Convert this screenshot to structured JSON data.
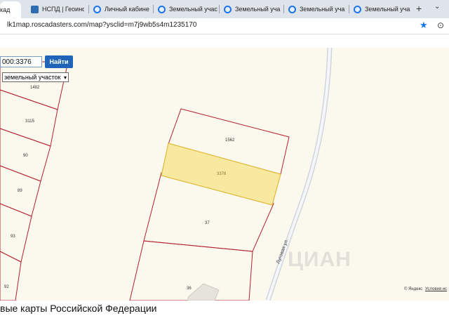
{
  "tabs": [
    {
      "label": "кад",
      "favicon": "globe-icon",
      "active": true
    },
    {
      "label": "НСПД | Геоинф",
      "favicon": "nspd-icon"
    },
    {
      "label": "Личный кабине",
      "favicon": "globe-icon"
    },
    {
      "label": "Земельный учас",
      "favicon": "globe-icon"
    },
    {
      "label": "Земельный уча",
      "favicon": "globe-icon"
    },
    {
      "label": "Земельный уча",
      "favicon": "globe-icon"
    },
    {
      "label": "Земельный уча",
      "favicon": "globe-icon"
    }
  ],
  "new_tab": "+",
  "tab_menu": "⌄",
  "address": {
    "url": "lk1map.roscadasters.com/map?ysclid=m7j9wb5s4m1235170"
  },
  "search": {
    "value": "000:3376",
    "button": "Найти",
    "type_select": "земельный участок"
  },
  "parcels": {
    "left": [
      "1482",
      "3115",
      "90",
      "89",
      "93",
      "92"
    ],
    "center": [
      "1562",
      "3376",
      "37",
      "36"
    ],
    "selected": "3376"
  },
  "road_label": "Луговая ул.",
  "attribution": {
    "yandex": "© Яндекс",
    "terms": "Условия ис"
  },
  "watermark": "ЦИАН",
  "page_heading": "вые карты Российской Федерации",
  "colors": {
    "parcel_border": "#b3202f",
    "selected_fill": "#f7e9a0",
    "selected_border": "#e0b93a",
    "map_bg": "#fbf8ee",
    "road": "#d0d6df"
  }
}
